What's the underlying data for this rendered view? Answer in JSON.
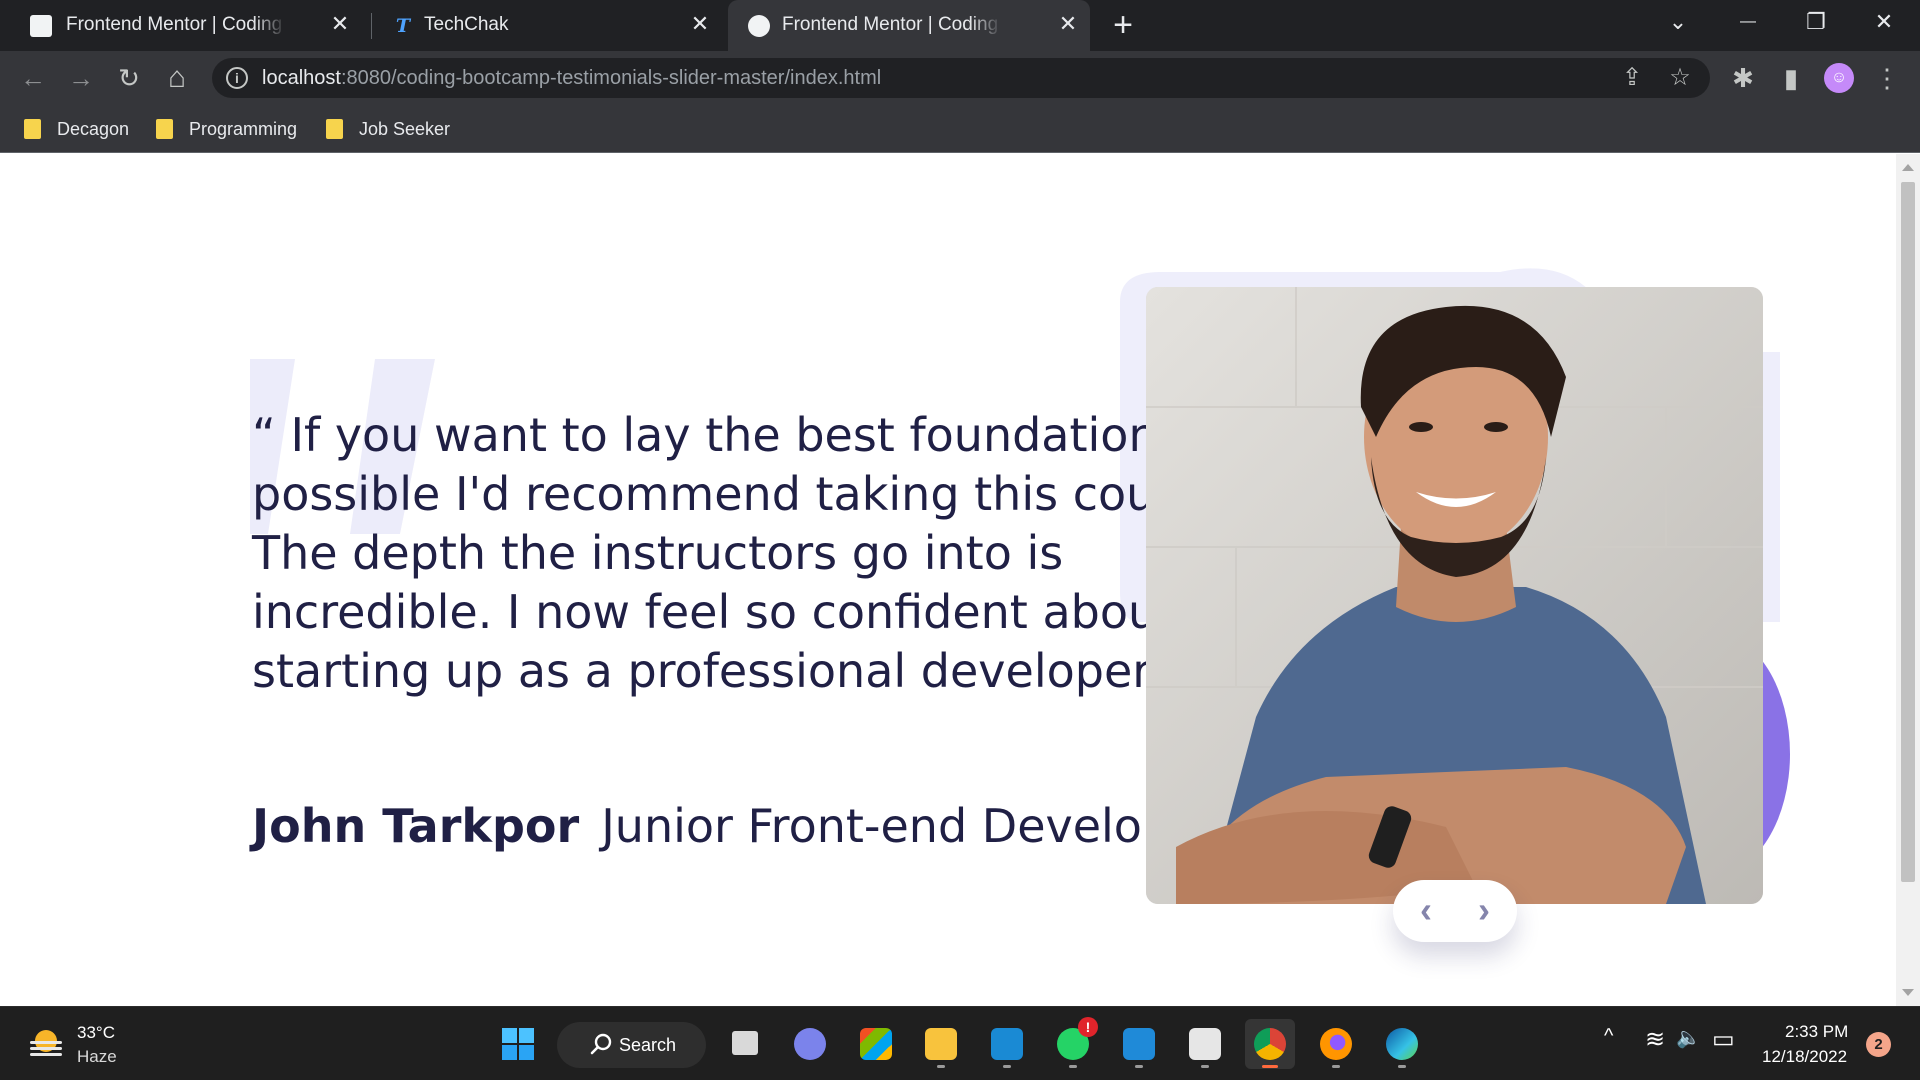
{
  "browser": {
    "tabs": [
      {
        "title": "Frontend Mentor | Coding bootcamp testimonials slider",
        "active": false
      },
      {
        "title": "TechChak",
        "active": false,
        "favicon_letter": "T"
      },
      {
        "title": "Frontend Mentor | Coding Bootcamp testimonials slider",
        "active": true
      }
    ],
    "close_glyph": "✕",
    "new_tab_glyph": "+",
    "window_controls": {
      "tab_search": "⌄",
      "minimize": "—",
      "restore": "❐",
      "close": "✕"
    },
    "nav": {
      "back": "←",
      "forward": "→",
      "reload": "↻",
      "home": "⌂"
    },
    "address": {
      "host": "localhost",
      "path": ":8080/coding-bootcamp-testimonials-slider-master/index.html",
      "info_glyph": "i"
    },
    "actions": {
      "share": "⇪",
      "star": "☆",
      "extensions": "✱",
      "side_panel": "▮",
      "menu": "⋮"
    },
    "bookmarks": [
      {
        "label": "Decagon"
      },
      {
        "label": "Programming"
      },
      {
        "label": "Job Seeker"
      }
    ]
  },
  "testimonial": {
    "quote": "“ If you want to lay the best foundation possible I'd recommend taking this course. The depth the instructors go into is incredible. I now feel so confident about starting up as a professional developer. ”",
    "author_name": "John Tarkpor",
    "author_role": "Junior Front-end Developer",
    "prev_glyph": "‹",
    "next_glyph": "›"
  },
  "taskbar": {
    "weather": {
      "temp": "33°C",
      "condition": "Haze"
    },
    "search_label": "Search",
    "apps": [
      "start",
      "search",
      "task-view",
      "teams-chat",
      "microsoft-store",
      "file-explorer",
      "mail",
      "whatsapp",
      "vscode",
      "rstudio",
      "chrome",
      "firefox",
      "edge"
    ],
    "whatsapp_badge": "!",
    "tray": {
      "chevron": "^",
      "wifi": "≋",
      "volume": "🔈",
      "battery": "▭"
    },
    "clock": {
      "time": "2:33 PM",
      "date": "12/18/2022"
    },
    "notifications": "2"
  },
  "colors": {
    "text_dark": "#202045",
    "accent_purple": "#8a72e6",
    "pattern_lavender": "#eeeefb",
    "chrome_dark": "#202124",
    "chrome_toolbar": "#35363a"
  }
}
